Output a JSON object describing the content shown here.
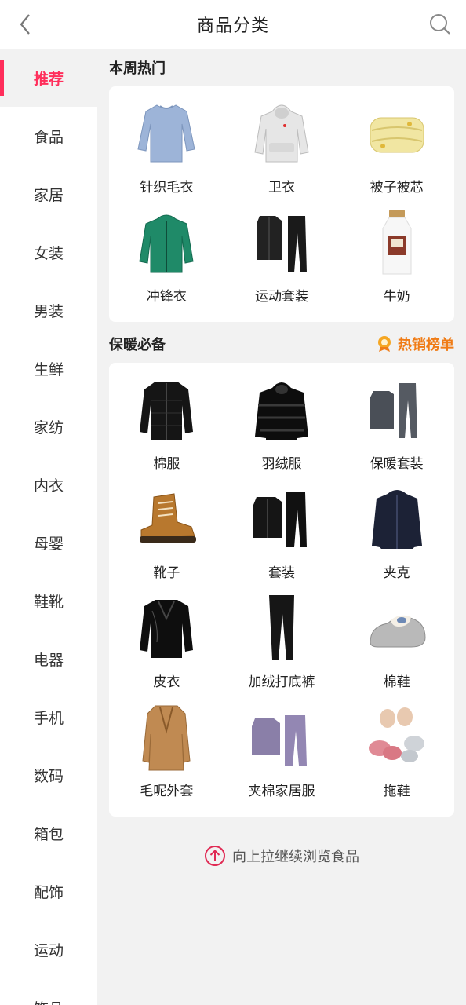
{
  "header": {
    "title": "商品分类"
  },
  "sidebar": {
    "items": [
      {
        "label": "推荐"
      },
      {
        "label": "食品"
      },
      {
        "label": "家居"
      },
      {
        "label": "女装"
      },
      {
        "label": "男装"
      },
      {
        "label": "生鲜"
      },
      {
        "label": "家纺"
      },
      {
        "label": "内衣"
      },
      {
        "label": "母婴"
      },
      {
        "label": "鞋靴"
      },
      {
        "label": "电器"
      },
      {
        "label": "手机"
      },
      {
        "label": "数码"
      },
      {
        "label": "箱包"
      },
      {
        "label": "配饰"
      },
      {
        "label": "运动"
      },
      {
        "label": "饰品"
      }
    ]
  },
  "sections": {
    "weekly": {
      "title": "本周热门",
      "items": [
        {
          "label": "针织毛衣"
        },
        {
          "label": "卫衣"
        },
        {
          "label": "被子被芯"
        },
        {
          "label": "冲锋衣"
        },
        {
          "label": "运动套装"
        },
        {
          "label": "牛奶"
        }
      ]
    },
    "warm": {
      "title": "保暖必备",
      "hot_label": "热销榜单",
      "items": [
        {
          "label": "棉服"
        },
        {
          "label": "羽绒服"
        },
        {
          "label": "保暖套装"
        },
        {
          "label": "靴子"
        },
        {
          "label": "套装"
        },
        {
          "label": "夹克"
        },
        {
          "label": "皮衣"
        },
        {
          "label": "加绒打底裤"
        },
        {
          "label": "棉鞋"
        },
        {
          "label": "毛呢外套"
        },
        {
          "label": "夹棉家居服"
        },
        {
          "label": "拖鞋"
        }
      ]
    }
  },
  "footer": {
    "tip": "向上拉继续浏览食品"
  },
  "colors": {
    "accent": "#ff2e5b",
    "hot": "#f07c16"
  }
}
